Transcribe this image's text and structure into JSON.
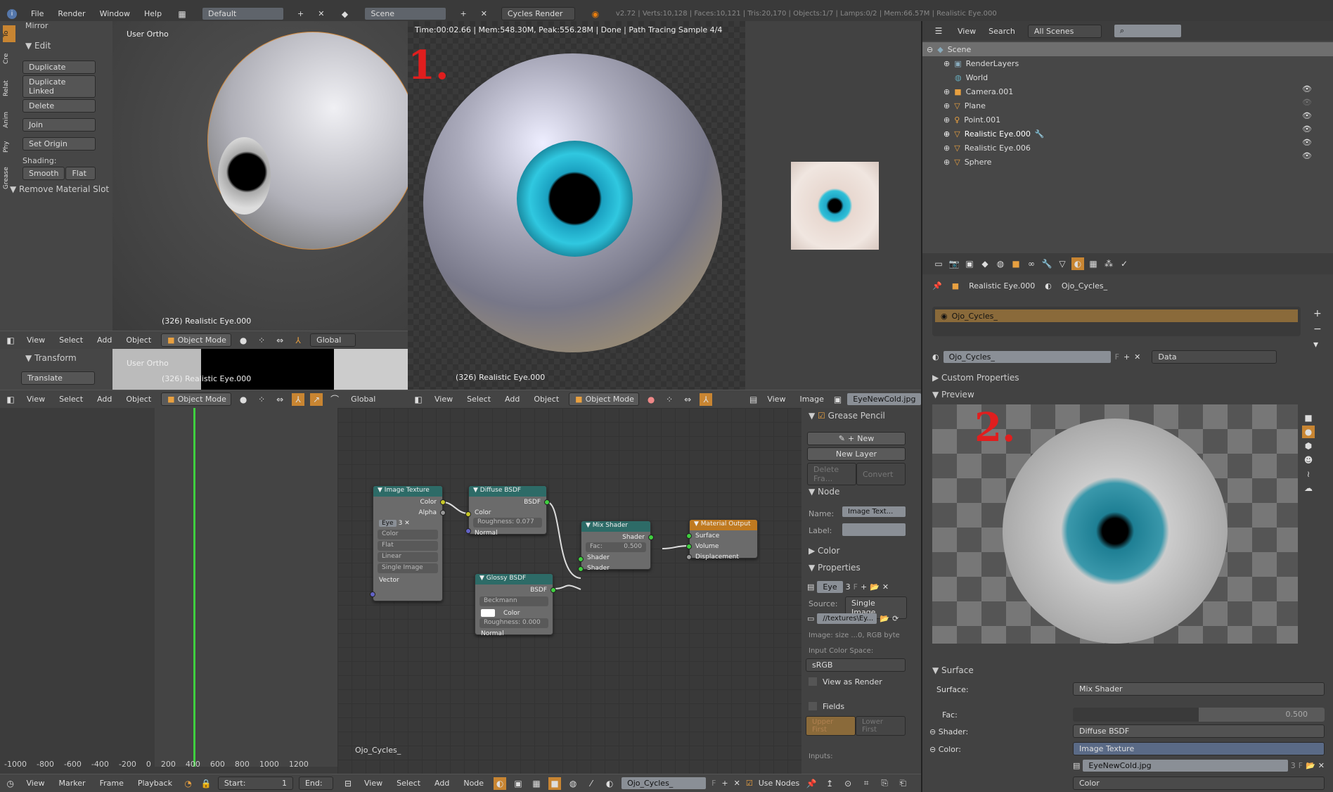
{
  "topbar": {
    "menus": [
      "File",
      "Render",
      "Window",
      "Help"
    ],
    "screen_layout": "Default",
    "scene": "Scene",
    "render_engine": "Cycles Render",
    "stats": "v2.72 | Verts:10,128 | Faces:10,121 | Tris:20,170 | Objects:1/7 | Lamps:0/2 | Mem:66.57M | Realistic Eye.000"
  },
  "toolshelf": {
    "tabs": [
      "To",
      "Cre",
      "Relat",
      "Anim",
      "Phy",
      "Grease"
    ],
    "mirror": "Mirror",
    "edit_header": "Edit",
    "buttons": [
      "Duplicate",
      "Duplicate Linked",
      "Delete",
      "Join"
    ],
    "set_origin": "Set Origin",
    "shading_label": "Shading:",
    "smooth": "Smooth",
    "flat": "Flat",
    "remove_material_slot": "Remove Material Slot",
    "transform_header": "Transform",
    "translate": "Translate"
  },
  "viewport1": {
    "view_label": "User Ortho",
    "object_label": "(326) Realistic Eye.000"
  },
  "viewport2": {
    "view_label": "User Ortho",
    "object_label": "(326) Realistic Eye.000"
  },
  "view3d_header": {
    "menus": [
      "View",
      "Select",
      "Add",
      "Object"
    ],
    "mode": "Object Mode",
    "orientation": "Global"
  },
  "render_view": {
    "status": "Time:00:02.66 | Mem:548.30M, Peak:556.28M | Done | Path Tracing Sample 4/4",
    "annotation": "1.",
    "object_label": "(326) Realistic Eye.000"
  },
  "image_editor": {
    "menus": [
      "View",
      "Image"
    ],
    "image_name": "EyeNewCold.jpg"
  },
  "outliner": {
    "menus": [
      "View",
      "Search"
    ],
    "filter": "All Scenes",
    "search_placeholder": "",
    "items": [
      {
        "name": "Scene",
        "level": 0,
        "selected": true
      },
      {
        "name": "RenderLayers",
        "level": 1
      },
      {
        "name": "World",
        "level": 1
      },
      {
        "name": "Camera.001",
        "level": 1
      },
      {
        "name": "Plane",
        "level": 1
      },
      {
        "name": "Point.001",
        "level": 1
      },
      {
        "name": "Realistic Eye.000",
        "level": 1,
        "active": true
      },
      {
        "name": "Realistic Eye.006",
        "level": 1
      },
      {
        "name": "Sphere",
        "level": 1
      }
    ]
  },
  "properties": {
    "breadcrumb_object": "Realistic Eye.000",
    "breadcrumb_material": "Ojo_Cycles_",
    "slot_name": "Ojo_Cycles_",
    "material_name": "Ojo_Cycles_",
    "fake_user": "F",
    "link": "Data",
    "custom_properties": "Custom Properties",
    "preview": "Preview",
    "preview_annotation": "2.",
    "surface_header": "Surface",
    "surface_label": "Surface:",
    "surface_value": "Mix Shader",
    "fac_label": "Fac:",
    "fac_value": "0.500",
    "fac_fraction": 0.5,
    "shader_label": "Shader:",
    "shader_value": "Diffuse BSDF",
    "color_label": "Color:",
    "color_value": "Image Texture",
    "image_name": "EyeNewCold.jpg",
    "image_users": "3",
    "color_mode": "Color"
  },
  "timeline": {
    "ticks": [
      "-1000",
      "-800",
      "-600",
      "-400",
      "-200",
      "0",
      "200",
      "400",
      "600",
      "800",
      "1000",
      "1200"
    ],
    "menus": [
      "View",
      "Marker",
      "Frame",
      "Playback"
    ],
    "start_label": "Start:",
    "start_value": "1",
    "end_label": "End:"
  },
  "node_editor": {
    "material_label": "Ojo_Cycles_",
    "menus": [
      "View",
      "Select",
      "Add",
      "Node"
    ],
    "material_name": "Ojo_Cycles_",
    "fake_user": "F",
    "use_nodes": "Use Nodes",
    "nodes": {
      "image_texture": {
        "title": "Image Texture",
        "out_color": "Color",
        "out_alpha": "Alpha",
        "image": "Eye",
        "users": "3",
        "f": "F",
        "color": "Color",
        "proj": "Flat",
        "interp": "Linear",
        "source": "Single Image",
        "vector": "Vector"
      },
      "diffuse": {
        "title": "Diffuse BSDF",
        "out": "BSDF",
        "color": "Color",
        "roughness": "Roughness: 0.077",
        "normal": "Normal"
      },
      "glossy": {
        "title": "Glossy BSDF",
        "out": "BSDF",
        "distribution": "Beckmann",
        "color": "Color",
        "roughness": "Roughness: 0.000",
        "normal": "Normal"
      },
      "mix": {
        "title": "Mix Shader",
        "out": "Shader",
        "fac": "Fac:",
        "fac_value": "0.500",
        "in1": "Shader",
        "in2": "Shader"
      },
      "output": {
        "title": "Material Output",
        "surface": "Surface",
        "volume": "Volume",
        "displacement": "Displacement"
      }
    }
  },
  "node_sidebar": {
    "grease_pencil": "Grease Pencil",
    "new": "New",
    "new_layer": "New Layer",
    "delete_frame": "Delete Fra...",
    "convert": "Convert",
    "node_header": "Node",
    "name_label": "Name:",
    "name_value": "Image Text...",
    "label_label": "Label:",
    "color_header": "Color",
    "properties_header": "Properties",
    "image": "Eye",
    "users": "3",
    "f": "F",
    "source_label": "Source:",
    "source_value": "Single Image",
    "filepath": "//textures\\Ey...",
    "image_info": "Image: size ...0, RGB byte",
    "color_space_label": "Input Color Space:",
    "color_space": "sRGB",
    "view_as_render": "View as Render",
    "fields": "Fields",
    "upper_first": "Upper First",
    "lower_first": "Lower First",
    "inputs": "Inputs:"
  }
}
